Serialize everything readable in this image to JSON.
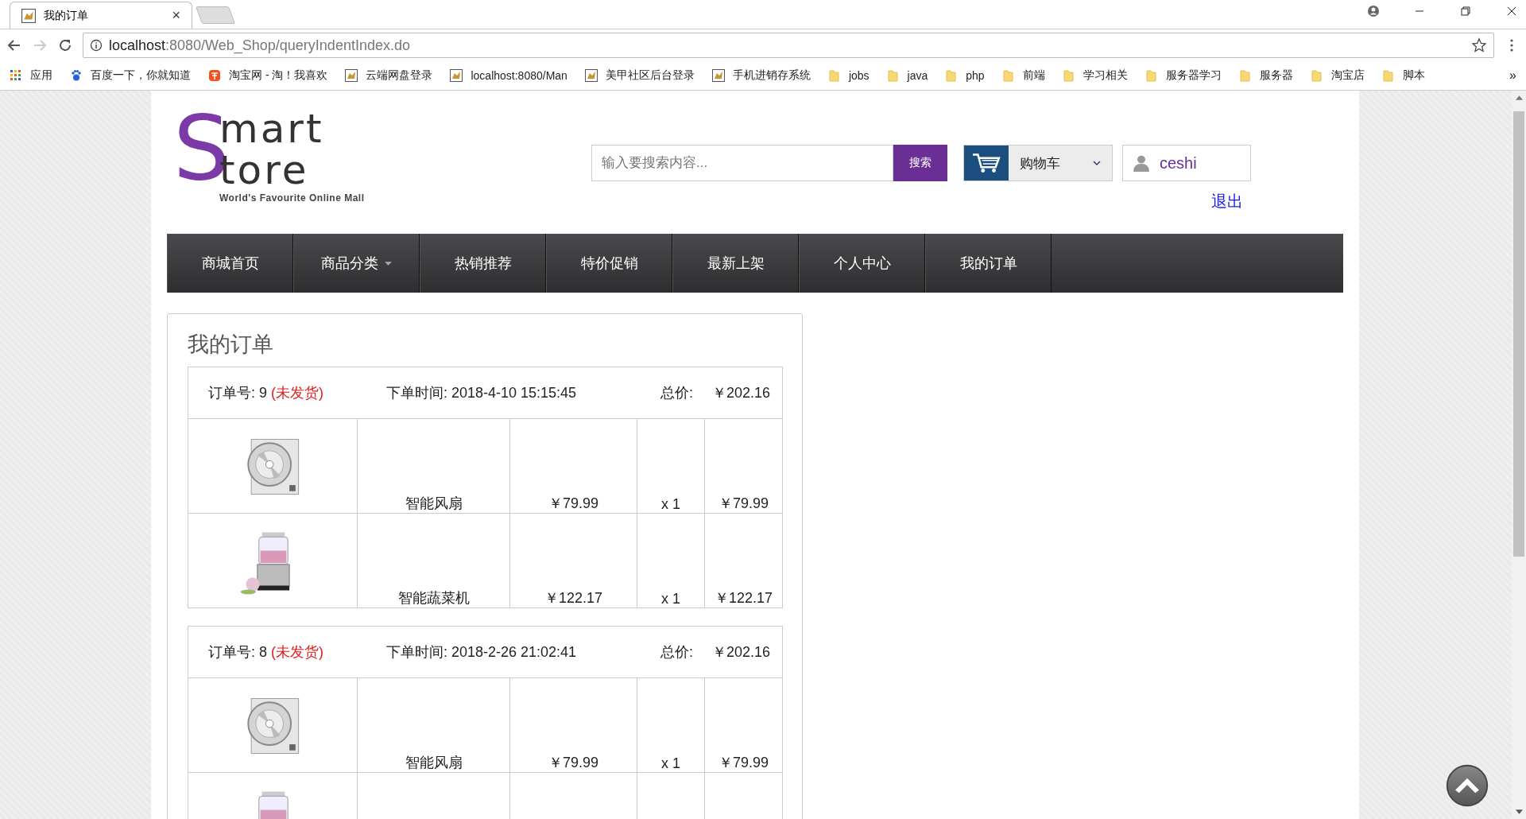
{
  "browser": {
    "tab": {
      "title": "我的订单",
      "close": "×"
    },
    "address": {
      "host": "localhost",
      "rest": ":8080/Web_Shop/queryIndentIndex.do"
    },
    "bookmarks": [
      {
        "kind": "apps",
        "label": "应用"
      },
      {
        "kind": "baidu",
        "label": "百度一下，你就知道"
      },
      {
        "kind": "taobao",
        "label": "淘宝网 - 淘！我喜欢"
      },
      {
        "kind": "page",
        "label": "云端网盘登录"
      },
      {
        "kind": "page",
        "label": "localhost:8080/Man"
      },
      {
        "kind": "page",
        "label": "美甲社区后台登录"
      },
      {
        "kind": "page",
        "label": "手机进销存系统"
      },
      {
        "kind": "folder",
        "label": "jobs"
      },
      {
        "kind": "folder",
        "label": "java"
      },
      {
        "kind": "folder",
        "label": "php"
      },
      {
        "kind": "folder",
        "label": "前端"
      },
      {
        "kind": "folder",
        "label": "学习相关"
      },
      {
        "kind": "folder",
        "label": "服务器学习"
      },
      {
        "kind": "folder",
        "label": "服务器"
      },
      {
        "kind": "folder",
        "label": "淘宝店"
      },
      {
        "kind": "folder",
        "label": "脚本"
      }
    ],
    "more": "»"
  },
  "logo": {
    "letter": "S",
    "line1": "mart",
    "line2": "tore",
    "tagline": "World's Favourite Online Mall"
  },
  "search": {
    "placeholder": "输入要搜索内容...",
    "button": "搜索"
  },
  "cart": {
    "label": "购物车"
  },
  "user": {
    "name": "ceshi",
    "logout": "退出"
  },
  "nav": [
    {
      "label": "商城首页",
      "kind": "link"
    },
    {
      "label": "商品分类",
      "kind": "dropdown"
    },
    {
      "label": "热销推荐",
      "kind": "link"
    },
    {
      "label": "特价促销",
      "kind": "link"
    },
    {
      "label": "最新上架",
      "kind": "link"
    },
    {
      "label": "个人中心",
      "kind": "link"
    },
    {
      "label": "我的订单",
      "kind": "link"
    }
  ],
  "orders_title": "我的订单",
  "orders": [
    {
      "number": "订单号: 9",
      "status": "(未发货)",
      "time": "下单时间: 2018-4-10 15:15:45",
      "total_label": "总价:",
      "total": "￥202.16",
      "items": [
        {
          "image": {
            "kind": "picture"
          },
          "name": "智能风扇",
          "price": "￥79.99",
          "qty": "x 1",
          "subtotal": "￥79.99"
        },
        {
          "image": {
            "kind": "picture"
          },
          "name": "智能蔬菜机",
          "price": "￥122.17",
          "qty": "x 1",
          "subtotal": "￥122.17"
        }
      ]
    },
    {
      "number": "订单号: 8",
      "status": "(未发货)",
      "time": "下单时间: 2018-2-26 21:02:41",
      "total_label": "总价:",
      "total": "￥202.16",
      "items": [
        {
          "image": {
            "kind": "picture"
          },
          "name": "智能风扇",
          "price": "￥79.99",
          "qty": "x 1",
          "subtotal": "￥79.99"
        },
        {
          "image": {
            "kind": "picture"
          }
        }
      ]
    }
  ]
}
